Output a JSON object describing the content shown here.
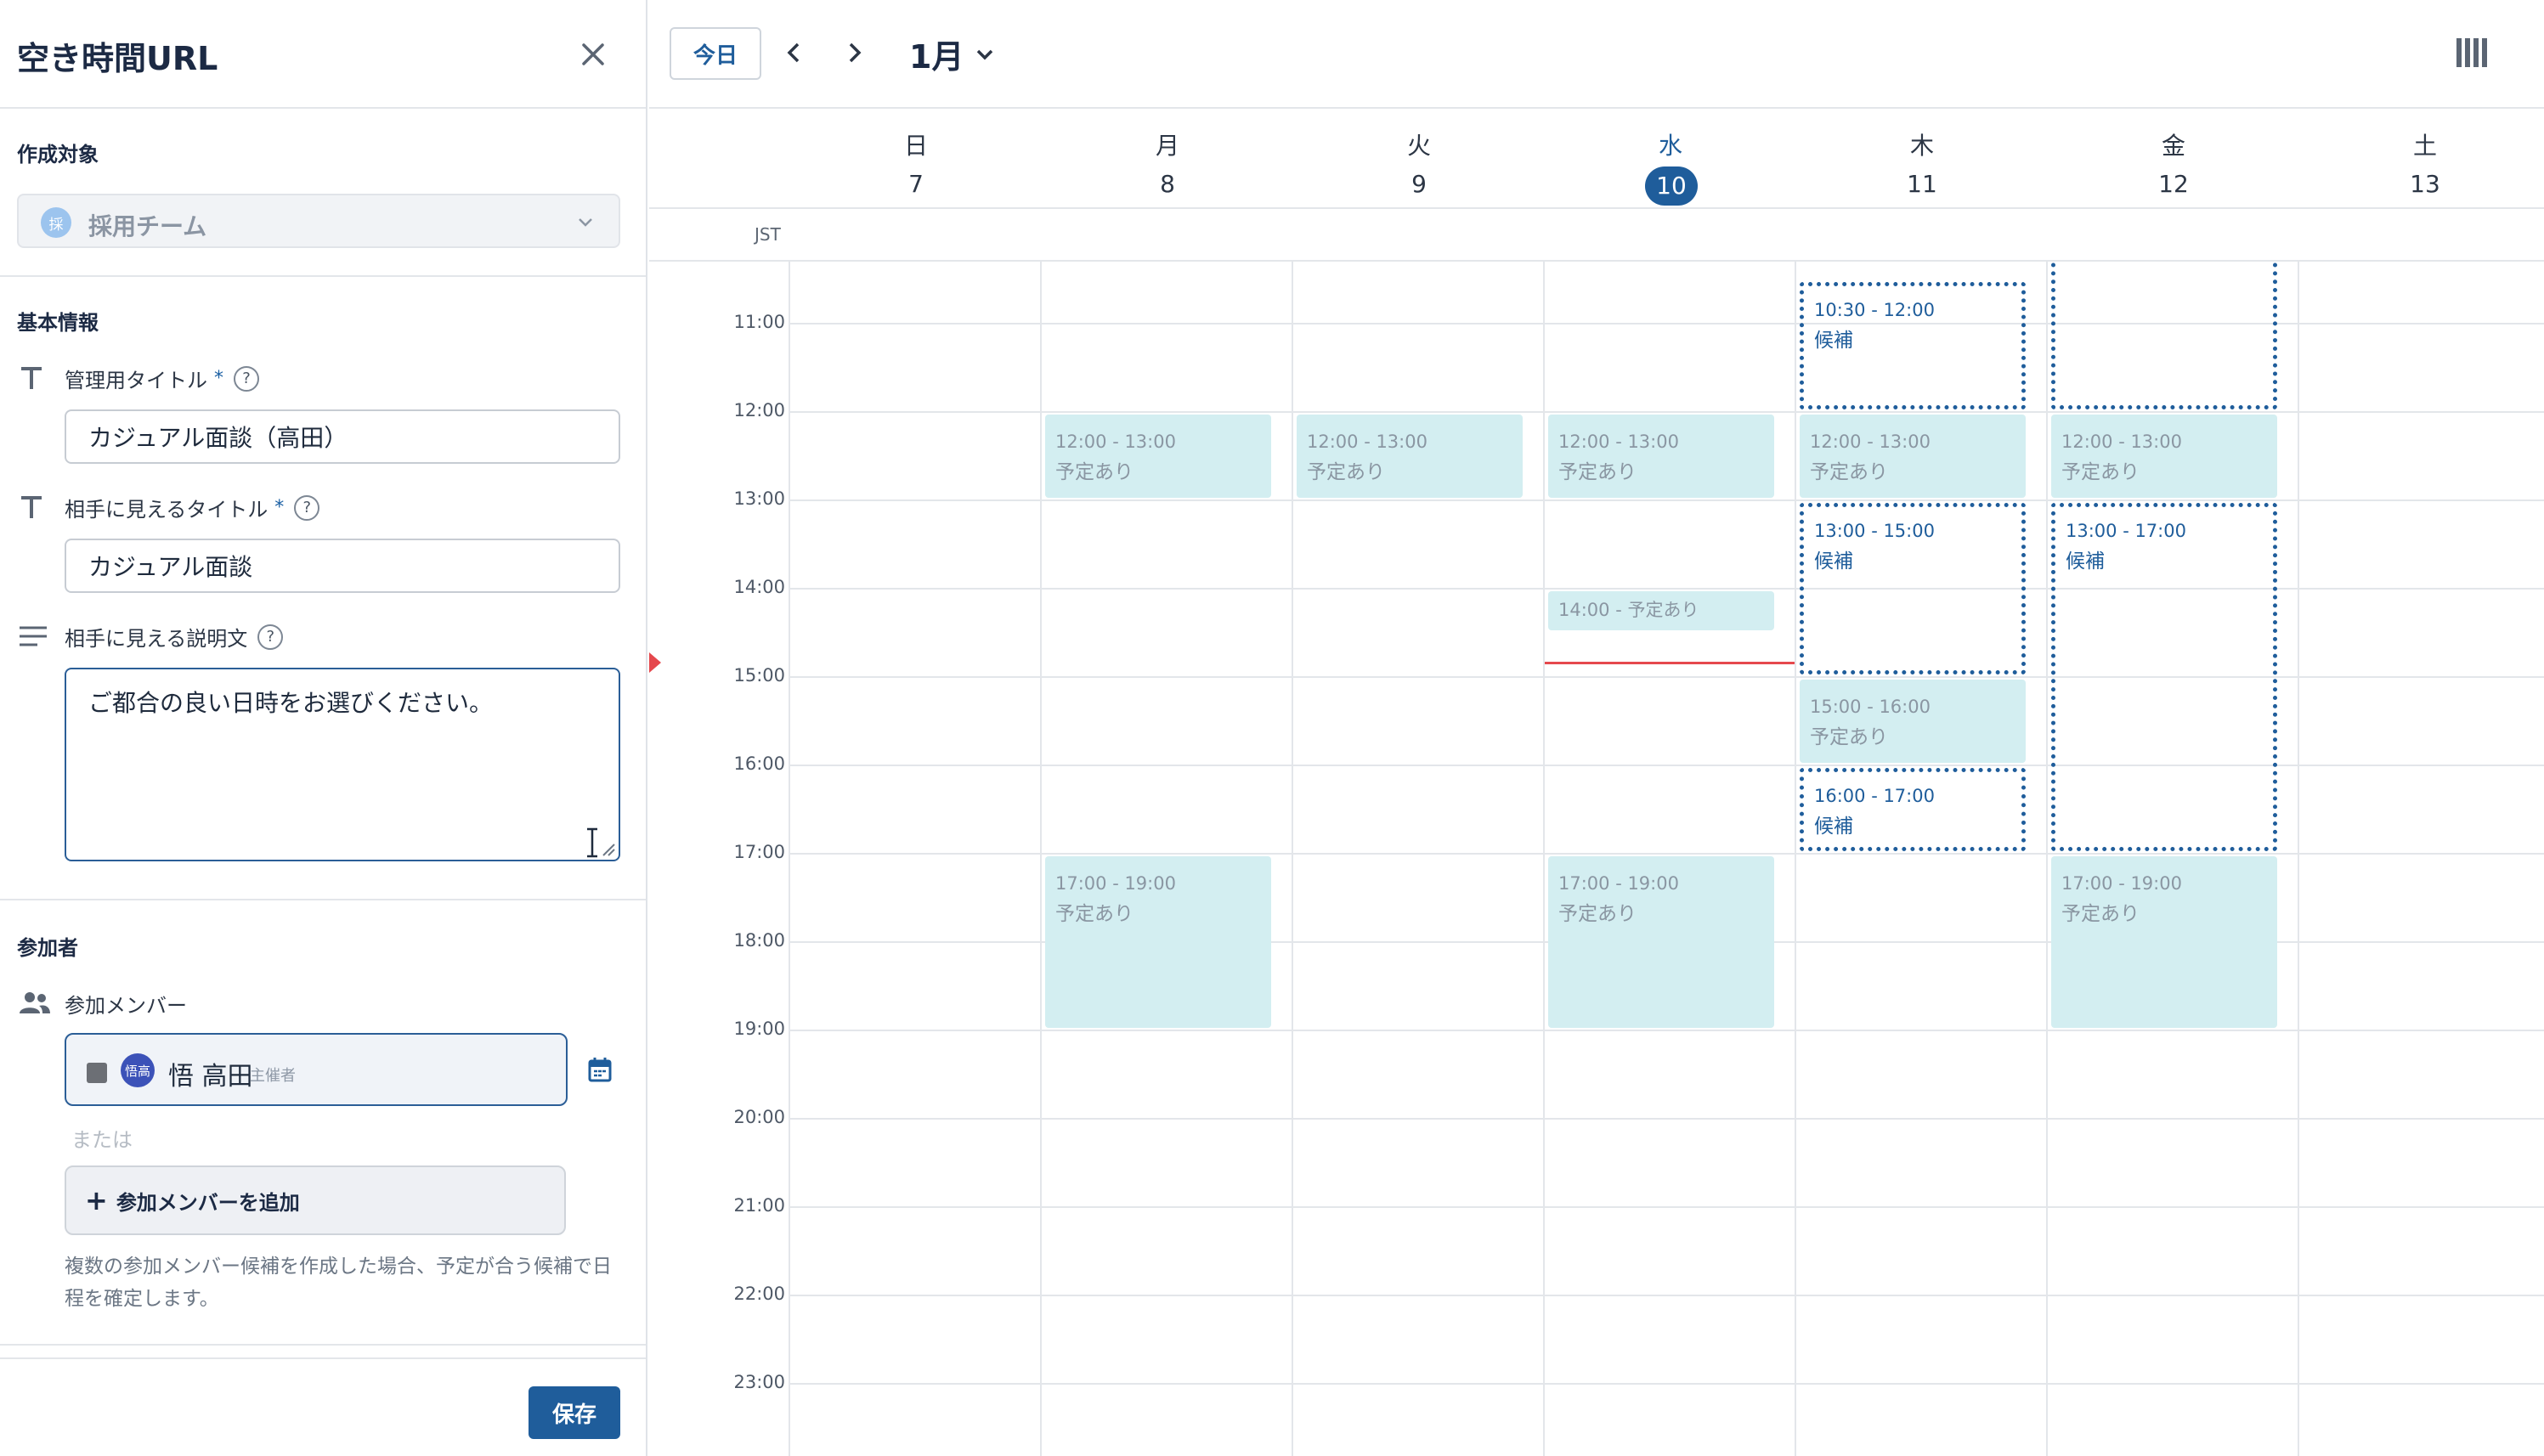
{
  "panel": {
    "title": "空き時間URL",
    "target_section": "作成対象",
    "target_avatar": "採",
    "target_value": "採用チーム",
    "basic_section": "基本情報",
    "admin_title_label": "管理用タイトル",
    "admin_title_value": "カジュアル面談（高田）",
    "visible_title_label": "相手に見えるタイトル",
    "visible_title_value": "カジュアル面談",
    "description_label": "相手に見える説明文",
    "description_value": "ご都合の良い日時をお選びください。",
    "required_mark": "*",
    "help_mark": "?",
    "participants_section": "参加者",
    "members_label": "参加メンバー",
    "member_avatar": "悟高",
    "member_name": "悟 高田",
    "member_role": "主催者",
    "or_text": "または",
    "add_member_label": "参加メンバーを追加",
    "help_text": "複数の参加メンバー候補を作成した場合、予定が合う候補で日程を確定します。",
    "save_label": "保存"
  },
  "calendar": {
    "today_label": "今日",
    "month_label": "1月",
    "timezone": "JST",
    "days": [
      {
        "dow": "日",
        "num": "7"
      },
      {
        "dow": "月",
        "num": "8"
      },
      {
        "dow": "火",
        "num": "9"
      },
      {
        "dow": "水",
        "num": "10",
        "today": true
      },
      {
        "dow": "木",
        "num": "11"
      },
      {
        "dow": "金",
        "num": "12"
      },
      {
        "dow": "土",
        "num": "13"
      }
    ],
    "hours": [
      "11:00",
      "12:00",
      "13:00",
      "14:00",
      "15:00",
      "16:00",
      "17:00",
      "18:00",
      "19:00",
      "20:00",
      "21:00",
      "22:00",
      "23:00"
    ],
    "events": [
      {
        "day": 1,
        "start": "12:00",
        "end": "13:00",
        "time": "12:00 - 13:00",
        "label": "予定あり",
        "kind": "busy"
      },
      {
        "day": 2,
        "start": "12:00",
        "end": "13:00",
        "time": "12:00 - 13:00",
        "label": "予定あり",
        "kind": "busy"
      },
      {
        "day": 3,
        "start": "12:00",
        "end": "13:00",
        "time": "12:00 - 13:00",
        "label": "予定あり",
        "kind": "busy"
      },
      {
        "day": 4,
        "start": "12:00",
        "end": "13:00",
        "time": "12:00 - 13:00",
        "label": "予定あり",
        "kind": "busy"
      },
      {
        "day": 5,
        "start": "12:00",
        "end": "13:00",
        "time": "12:00 - 13:00",
        "label": "予定あり",
        "kind": "busy"
      },
      {
        "day": 3,
        "start": "14:00",
        "end": "14:30",
        "time": "14:00 - 予定あり",
        "label": "",
        "kind": "busy-inline"
      },
      {
        "day": 4,
        "start": "15:00",
        "end": "16:00",
        "time": "15:00 - 16:00",
        "label": "予定あり",
        "kind": "busy"
      },
      {
        "day": 1,
        "start": "17:00",
        "end": "19:00",
        "time": "17:00 - 19:00",
        "label": "予定あり",
        "kind": "busy"
      },
      {
        "day": 3,
        "start": "17:00",
        "end": "19:00",
        "time": "17:00 - 19:00",
        "label": "予定あり",
        "kind": "busy"
      },
      {
        "day": 5,
        "start": "17:00",
        "end": "19:00",
        "time": "17:00 - 19:00",
        "label": "予定あり",
        "kind": "busy"
      },
      {
        "day": 4,
        "start": "10:30",
        "end": "12:00",
        "time": "10:30 - 12:00",
        "label": "候補",
        "kind": "candidate"
      },
      {
        "day": 4,
        "start": "13:00",
        "end": "15:00",
        "time": "13:00 - 15:00",
        "label": "候補",
        "kind": "candidate"
      },
      {
        "day": 4,
        "start": "16:00",
        "end": "17:00",
        "time": "16:00 - 17:00",
        "label": "候補",
        "kind": "candidate"
      },
      {
        "day": 5,
        "start": "10:00",
        "end": "12:00",
        "time": "",
        "label": "",
        "kind": "candidate"
      },
      {
        "day": 5,
        "start": "13:00",
        "end": "17:00",
        "time": "13:00 - 17:00",
        "label": "候補",
        "kind": "candidate"
      }
    ],
    "now": {
      "day": 3,
      "time": "14:50"
    }
  }
}
